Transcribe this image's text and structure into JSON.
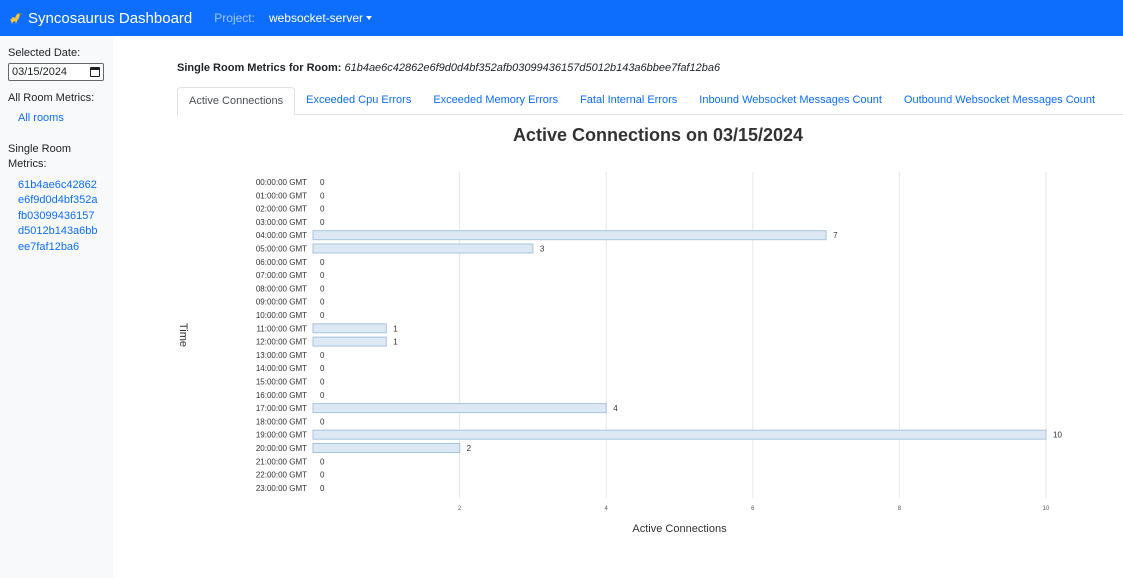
{
  "navbar": {
    "brand": "Syncosaurus Dashboard",
    "project_label": "Project:",
    "project_value": "websocket-server"
  },
  "sidebar": {
    "selected_date_label": "Selected Date:",
    "date_value": "03/15/2024",
    "all_room_label": "All Room Metrics:",
    "all_rooms_link": "All rooms",
    "single_room_label": "Single Room Metrics:",
    "room_id_lines": [
      "61b4ae6c42862",
      "e6f9d0d4bf352a",
      "fb03099436157",
      "d5012b143a6bb",
      "ee7faf12ba6"
    ]
  },
  "main": {
    "heading_label": "Single Room Metrics for Room:",
    "room_id": "61b4ae6c42862e6f9d0d4bf352afb03099436157d5012b143a6bbee7faf12ba6",
    "tabs": [
      {
        "label": "Active Connections",
        "active": true
      },
      {
        "label": "Exceeded Cpu Errors",
        "active": false
      },
      {
        "label": "Exceeded Memory Errors",
        "active": false
      },
      {
        "label": "Fatal Internal Errors",
        "active": false
      },
      {
        "label": "Inbound Websocket Messages Count",
        "active": false
      },
      {
        "label": "Outbound Websocket Messages Count",
        "active": false
      }
    ]
  },
  "chart_data": {
    "type": "bar",
    "orientation": "horizontal",
    "title": "Active Connections on 03/15/2024",
    "xlabel": "Active Connections",
    "ylabel": "Time",
    "xlim": [
      0,
      10
    ],
    "xticks": [
      2,
      4,
      6,
      8,
      10
    ],
    "grid": true,
    "bar_color": "#dce9f5",
    "bar_border": "#a8c4dd",
    "categories": [
      "00:00:00 GMT",
      "01:00:00 GMT",
      "02:00:00 GMT",
      "03:00:00 GMT",
      "04:00:00 GMT",
      "05:00:00 GMT",
      "06:00:00 GMT",
      "07:00:00 GMT",
      "08:00:00 GMT",
      "09:00:00 GMT",
      "10:00:00 GMT",
      "11:00:00 GMT",
      "12:00:00 GMT",
      "13:00:00 GMT",
      "14:00:00 GMT",
      "15:00:00 GMT",
      "16:00:00 GMT",
      "17:00:00 GMT",
      "18:00:00 GMT",
      "19:00:00 GMT",
      "20:00:00 GMT",
      "21:00:00 GMT",
      "22:00:00 GMT",
      "23:00:00 GMT"
    ],
    "values": [
      0,
      0,
      0,
      0,
      7,
      3,
      0,
      0,
      0,
      0,
      0,
      1,
      1,
      0,
      0,
      0,
      0,
      4,
      0,
      10,
      2,
      0,
      0,
      0
    ]
  }
}
